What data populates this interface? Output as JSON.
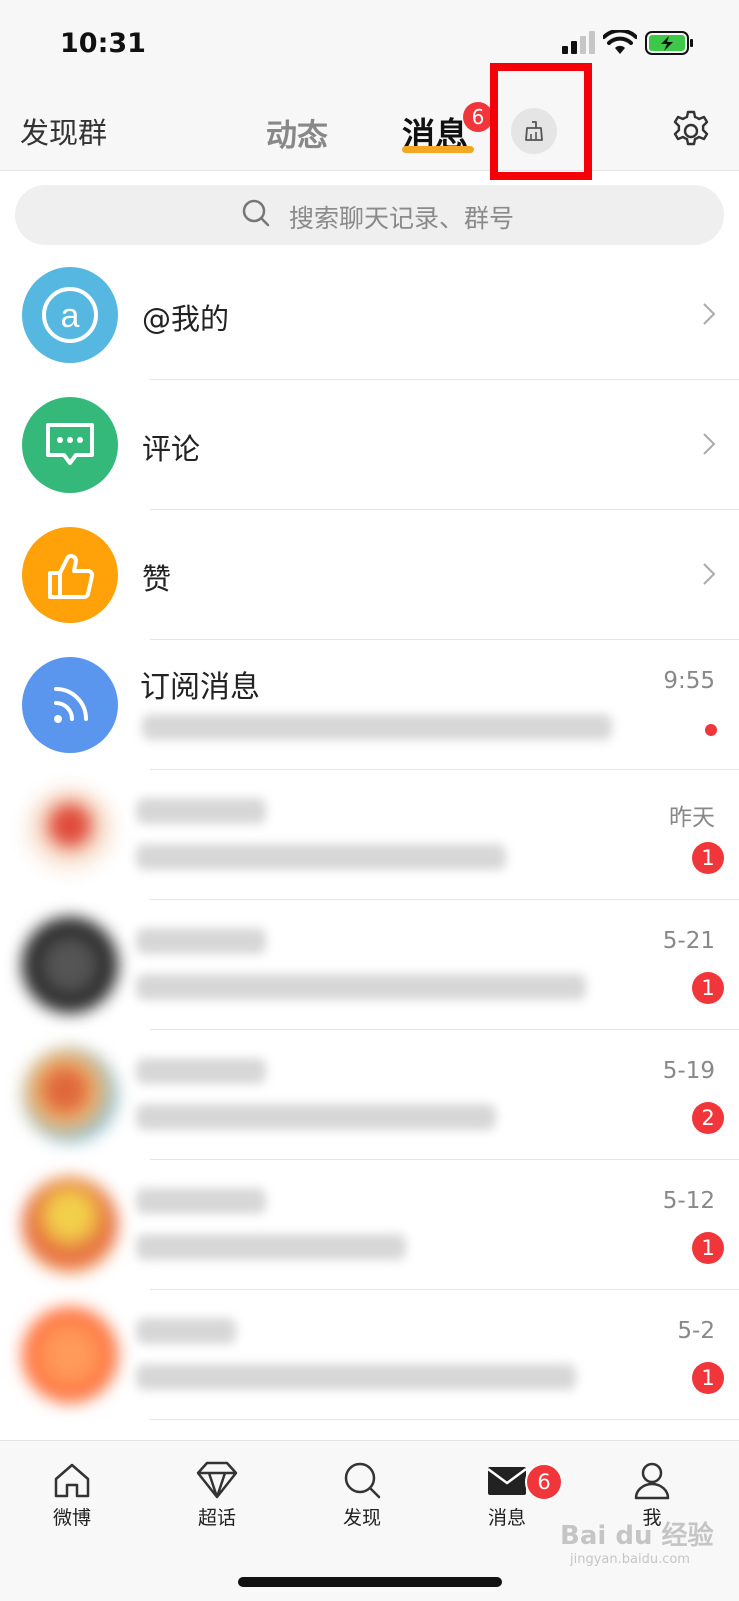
{
  "status_bar": {
    "time": "10:31"
  },
  "top_nav": {
    "left_label": "发现群",
    "tabs": [
      {
        "label": "动态",
        "active": false
      },
      {
        "label": "消息",
        "active": true,
        "badge": "6"
      }
    ],
    "clean_button_icon": "broom-icon",
    "settings_icon": "gear-icon"
  },
  "search": {
    "placeholder": "搜索聊天记录、群号"
  },
  "fixed_items": [
    {
      "label": "@我的",
      "icon": "at-icon",
      "color": "#56b8e0"
    },
    {
      "label": "评论",
      "icon": "comment-icon",
      "color": "#35b97a"
    },
    {
      "label": "赞",
      "icon": "thumbs-up-icon",
      "color": "#ffa20a"
    }
  ],
  "subscription": {
    "title": "订阅消息",
    "time": "9:55",
    "icon": "rss-icon",
    "color": "#5b96ee",
    "unread_dot": true
  },
  "conversations": [
    {
      "time": "昨天",
      "badge": "1"
    },
    {
      "time": "5-21",
      "badge": "1"
    },
    {
      "time": "5-19",
      "badge": "2"
    },
    {
      "time": "5-12",
      "badge": "1"
    },
    {
      "time": "5-2",
      "badge": "1"
    }
  ],
  "bottom_tabs": [
    {
      "label": "微博",
      "icon": "home-icon"
    },
    {
      "label": "超话",
      "icon": "diamond-icon"
    },
    {
      "label": "发现",
      "icon": "search-icon"
    },
    {
      "label": "消息",
      "icon": "mail-icon",
      "badge": "6"
    },
    {
      "label": "我",
      "icon": "person-icon"
    }
  ],
  "watermark": {
    "text": "Bai du 经验",
    "sub": "jingyan.baidu.com"
  },
  "colors": {
    "accent": "#f5a623",
    "badge": "#f0353b",
    "highlight": "#f50008"
  }
}
